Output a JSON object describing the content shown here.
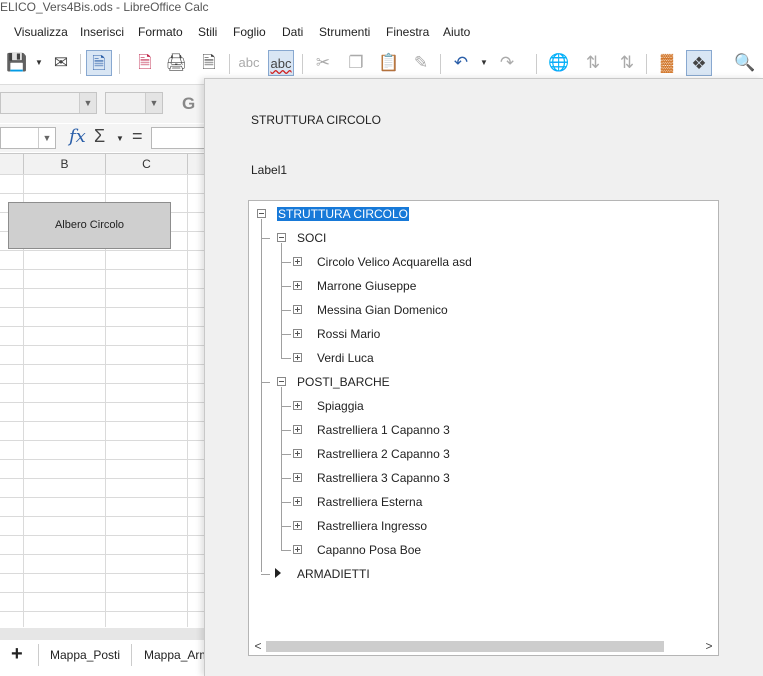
{
  "window": {
    "title": "ELICO_Vers4Bis.ods - LibreOffice Calc"
  },
  "menu": [
    "Visualizza",
    "Inserisci",
    "Formato",
    "Stili",
    "Foglio",
    "Dati",
    "Strumenti",
    "Finestra",
    "Aiuto"
  ],
  "toolbar": {
    "icons": [
      "save-icon",
      "email-icon",
      "edit-mode-icon",
      "export-pdf-icon",
      "print-icon",
      "print-preview-icon",
      "spellcheck-icon",
      "autospellcheck-icon",
      "cut-icon",
      "copy-icon",
      "paste-icon",
      "clone-format-icon",
      "undo-icon",
      "redo-icon",
      "hyperlink-icon",
      "sort-ascending-icon",
      "sort-descending-icon",
      "chart-icon",
      "navigator-icon",
      "find-icon"
    ],
    "spell_label": "abc",
    "font_style_letter": "G"
  },
  "formula_bar": {
    "fx": "fx",
    "sum": "Σ",
    "equals": "="
  },
  "columns": [
    "B",
    "C"
  ],
  "sheet_button": {
    "label": "Albero Circolo"
  },
  "sheet_tabs": {
    "add": "+",
    "tabs": [
      "Mappa_Posti",
      "Mappa_Arm"
    ]
  },
  "dialog": {
    "title": "STRUTTURA CIRCOLO",
    "label": "Label1",
    "tree": {
      "root": "STRUTTURA CIRCOLO",
      "groups": [
        {
          "label": "SOCI",
          "expanded": true,
          "items": [
            "Circolo Velico Acquarella asd",
            "Marrone Giuseppe",
            "Messina Gian Domenico",
            "Rossi Mario",
            "Verdi Luca"
          ]
        },
        {
          "label": "POSTI_BARCHE",
          "expanded": true,
          "items": [
            "Spiaggia",
            "Rastrelliera 1 Capanno 3",
            "Rastrelliera 2 Capanno 3",
            "Rastrelliera 3 Capanno 3",
            "Rastrelliera Esterna",
            "Rastrelliera Ingresso",
            "Capanno Posa Boe"
          ]
        },
        {
          "label": "ARMADIETTI",
          "expanded": false,
          "items": []
        }
      ]
    },
    "scroll": {
      "left": "<",
      "right": ">"
    }
  }
}
